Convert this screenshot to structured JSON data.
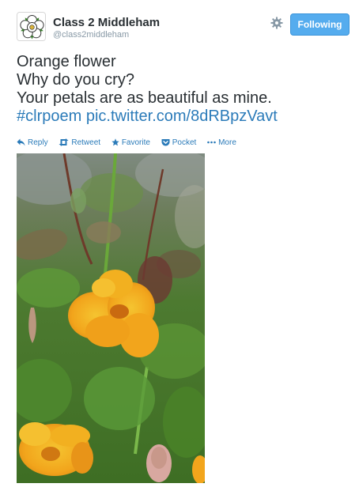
{
  "user": {
    "fullname": "Class 2 Middleham",
    "username": "@class2middleham"
  },
  "follow_button": {
    "label": "Following"
  },
  "icons": {
    "avatar": "yorkshire-rose-icon",
    "settings": "gear-icon",
    "reply": "reply-icon",
    "retweet": "retweet-icon",
    "favorite": "star-icon",
    "pocket": "pocket-icon",
    "more": "more-dots-icon"
  },
  "tweet": {
    "lines": [
      "Orange flower",
      "Why do you cry?",
      "Your petals are as beautiful as mine."
    ],
    "hashtag": "#clrpoem",
    "link": "pic.twitter.com/8dRBpzVavt"
  },
  "actions": {
    "reply": "Reply",
    "retweet": "Retweet",
    "favorite": "Favorite",
    "pocket": "Pocket",
    "more": "More"
  },
  "colors": {
    "accent": "#55acee",
    "link": "#2b7bb9",
    "text": "#292f33",
    "muted": "#8899a6"
  }
}
